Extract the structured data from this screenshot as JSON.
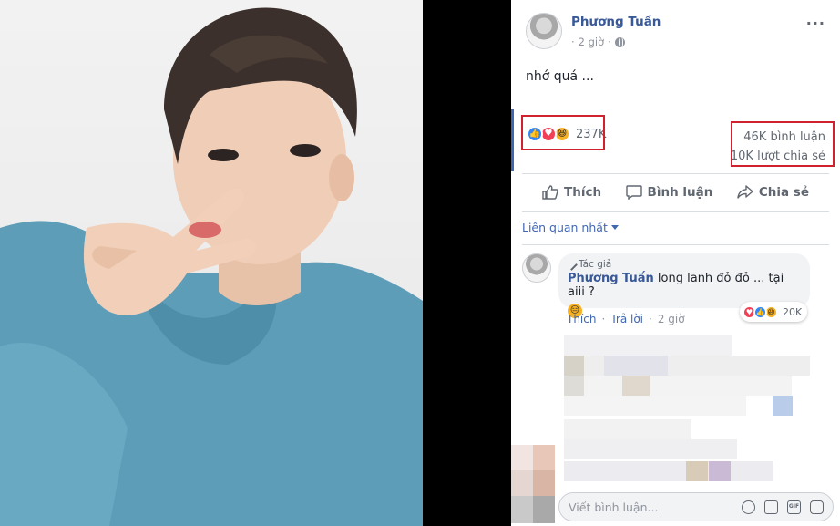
{
  "post": {
    "author": "Phương Tuấn",
    "time": "2 giờ",
    "text": "nhớ quá ...",
    "reaction_count": "237K",
    "comments_count": "46K bình luận",
    "shares_count": "10K lượt chia sẻ",
    "reaction_icons": [
      "like",
      "love",
      "haha"
    ]
  },
  "actions": {
    "like": "Thích",
    "comment": "Bình luận",
    "share": "Chia sẻ"
  },
  "comments": {
    "sort_label": "Liên quan nhất",
    "top": {
      "author_tag": "Tác giả",
      "author": "Phương Tuấn",
      "text": "long lanh đỏ đỏ ... tại aiii ?",
      "emoji": "😑",
      "reaction_count": "20K",
      "like": "Thích",
      "reply": "Trả lời",
      "time": "2 giờ"
    }
  },
  "composer": {
    "placeholder": "Viết bình luận..."
  },
  "colors": {
    "brand": "#4267b2",
    "name": "#385898",
    "highlight": "#d0212e",
    "hoodie": "#5f9fb8"
  },
  "icons": [
    "globe-icon",
    "more-icon",
    "like-icon",
    "comment-icon",
    "share-icon",
    "pen-icon",
    "emoji-icon",
    "camera-icon",
    "gif-icon",
    "sticker-icon"
  ]
}
